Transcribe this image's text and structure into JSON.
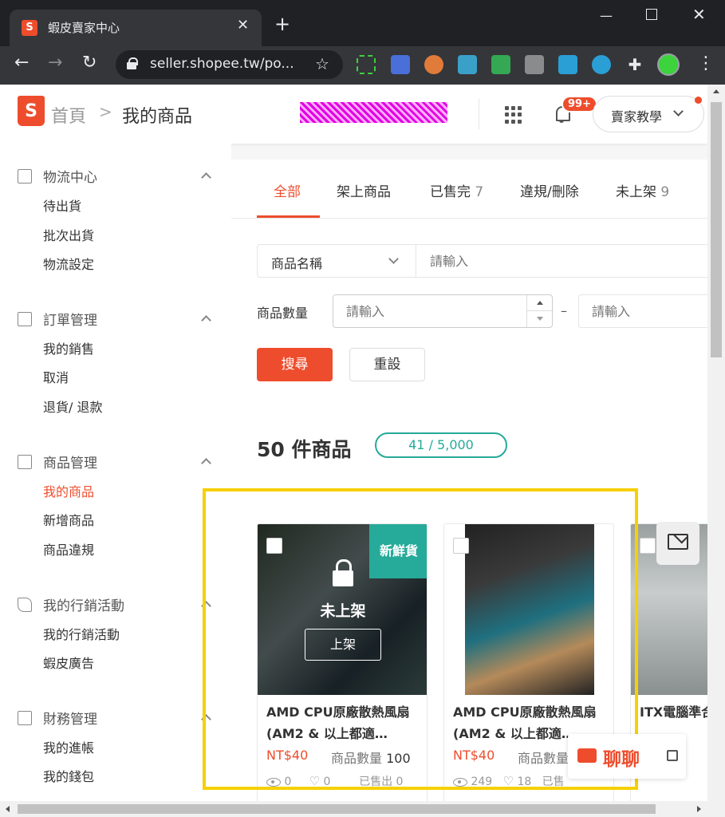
{
  "browser": {
    "tab_title": "蝦皮賣家中心",
    "tab_close": "✕",
    "new_tab": "+",
    "url": "seller.shopee.tw/po..."
  },
  "header": {
    "logo_letter": "S",
    "breadcrumb_home": "首頁",
    "breadcrumb_sep": ">",
    "breadcrumb_current": "我的商品",
    "notification_badge": "99+",
    "tutorial_label": "賣家教學"
  },
  "sidebar": {
    "sections": [
      {
        "title": "物流中心",
        "items": [
          "待出貨",
          "批次出貨",
          "物流設定"
        ]
      },
      {
        "title": "訂單管理",
        "items": [
          "我的銷售",
          "取消",
          "退貨/ 退款"
        ]
      },
      {
        "title": "商品管理",
        "items": [
          "我的商品",
          "新增商品",
          "商品違規"
        ]
      },
      {
        "title": "我的行銷活動",
        "items": [
          "我的行銷活動",
          "蝦皮廣告"
        ]
      },
      {
        "title": "財務管理",
        "items": [
          "我的進帳",
          "我的錢包"
        ]
      }
    ]
  },
  "tabs": [
    {
      "label": "全部",
      "count": ""
    },
    {
      "label": "架上商品",
      "count": ""
    },
    {
      "label": "已售完",
      "count": "7"
    },
    {
      "label": "違規/刪除",
      "count": ""
    },
    {
      "label": "未上架",
      "count": "9"
    }
  ],
  "filters": {
    "name_select": "商品名稱",
    "name_placeholder": "請輸入",
    "qty_label": "商品數量",
    "qty_min_placeholder": "請輸入",
    "range_dash": "–",
    "qty_max_placeholder": "請輸入",
    "search_label": "搜尋",
    "reset_label": "重設"
  },
  "summary": {
    "count_title": "50 件商品",
    "quota": "41 / 5,000"
  },
  "products": [
    {
      "name": "AMD CPU原廠散熱風扇 (AM2 & 以上都適…",
      "price": "NT$40",
      "stock_label": "商品數量",
      "stock": "100",
      "views": "0",
      "likes": "0",
      "sold": "已售出 0",
      "overlay_label": "未上架",
      "list_button": "上架",
      "tag": "新鮮貨"
    },
    {
      "name": "AMD CPU原廠散熱風扇 (AM2 & 以上都適…",
      "price": "NT$40",
      "stock_label": "商品數量",
      "views": "249",
      "likes": "18",
      "sold": "已售"
    },
    {
      "name": "ITX電腦準合金烤漆外"
    }
  ],
  "chat": {
    "label": "聊聊"
  },
  "colors": {
    "brand": "#ee4d2d",
    "teal": "#26aa99",
    "highlight": "#f6d000"
  }
}
